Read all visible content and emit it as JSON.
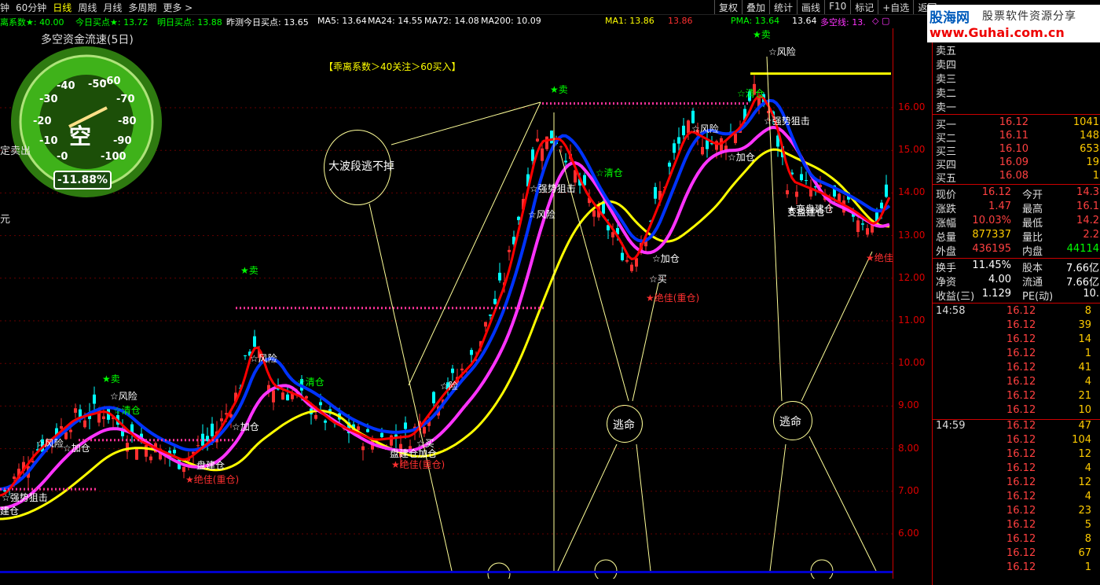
{
  "toolbar": {
    "periods": [
      "钟",
      "60分钟",
      "日线",
      "周线",
      "月线",
      "多周期",
      "更多 >"
    ],
    "active_period_index": 2,
    "buttons": [
      "复权",
      "叠加",
      "统计",
      "画线",
      "F10",
      "标记",
      "+自选",
      "返回"
    ]
  },
  "info_bar": {
    "deviation": "离系数★: 40.00",
    "today_buy": "今日买点★: 13.72",
    "tomorrow_buy": "明日买点: 13.88",
    "predicted": "昨测今日买点: 13.65",
    "ma5": "MA5: 13.64",
    "ma24": "MA24: 14.55",
    "ma72": "MA72: 14.08",
    "ma200": "MA200: 10.09",
    "ma1": "MA1: 13.86",
    "ma1b": "13.86",
    "pma": "PMA: 13.64",
    "pma2": "13.64",
    "kongxian": "多空线: 13."
  },
  "gauge": {
    "title": "多空资金流速(5日)",
    "labels": [
      "-40",
      "-50",
      "-60",
      "-30",
      "-70",
      "-20",
      "-80",
      "-10",
      "-90",
      "-0",
      "-100"
    ],
    "center_text": "空",
    "value": "-11.88%",
    "left_text": "定卖出"
  },
  "left_side_label_1": "元",
  "chart_annotation_top": "【乖离系数＞40关注＞60买入】",
  "circle_labels": {
    "big": "大波段逃不掉",
    "escape1": "逃命",
    "escape2": "逃命"
  },
  "chart_labels": [
    {
      "t": "☆强势狙击",
      "c": "#fff"
    },
    {
      "t": "建仓",
      "c": "#fff"
    },
    {
      "t": "☆风险",
      "c": "#fff"
    },
    {
      "t": "☆加仓",
      "c": "#fff"
    },
    {
      "t": "★卖",
      "c": "#00ff00"
    },
    {
      "t": "☆风险",
      "c": "#fff"
    },
    {
      "t": "☆清仓",
      "c": "#00ff00"
    },
    {
      "t": "盘建仓",
      "c": "#fff"
    },
    {
      "t": "★绝佳(重仓)",
      "c": "#ff3030"
    },
    {
      "t": "★卖",
      "c": "#00ff00"
    },
    {
      "t": "☆风险",
      "c": "#fff"
    },
    {
      "t": "☆清仓",
      "c": "#00ff00"
    },
    {
      "t": "☆加仓",
      "c": "#fff"
    },
    {
      "t": "☆险",
      "c": "#fff"
    },
    {
      "t": "☆买",
      "c": "#fff"
    },
    {
      "t": "盘建仓加仓",
      "c": "#fff"
    },
    {
      "t": "★绝佳(重仓)",
      "c": "#ff3030"
    },
    {
      "t": "★卖",
      "c": "#00ff00"
    },
    {
      "t": "☆强势狙击",
      "c": "#fff"
    },
    {
      "t": "☆风险",
      "c": "#fff"
    },
    {
      "t": "☆清仓",
      "c": "#00ff00"
    },
    {
      "t": "变盘建仓",
      "c": "#fff"
    },
    {
      "t": "☆加仓",
      "c": "#fff"
    },
    {
      "t": "☆买",
      "c": "#fff"
    },
    {
      "t": "★绝佳(重仓)",
      "c": "#ff3030"
    },
    {
      "t": "★卖",
      "c": "#00ff00"
    },
    {
      "t": "☆风险",
      "c": "#fff"
    },
    {
      "t": "☆清仓",
      "c": "#00ff00"
    },
    {
      "t": "☆风险",
      "c": "#fff"
    },
    {
      "t": "☆加仓",
      "c": "#fff"
    },
    {
      "t": "☆强势狙击",
      "c": "#fff"
    },
    {
      "t": "★变盘建仓",
      "c": "#fff"
    },
    {
      "t": "★绝佳",
      "c": "#ff3030"
    }
  ],
  "price_axis": [
    "16.00",
    "15.00",
    "14.00",
    "13.00",
    "12.00",
    "11.00",
    "10.00",
    "9.00",
    "8.00",
    "7.00",
    "6.00"
  ],
  "banner": {
    "logo": "股海网",
    "slogan": "股票软件资源分享",
    "url": "www.Guhai.com.cn"
  },
  "order_book": {
    "sell": [
      "卖五",
      "卖四",
      "卖三",
      "卖二",
      "卖一"
    ],
    "buy": [
      {
        "label": "买一",
        "price": "16.12",
        "vol": "1041"
      },
      {
        "label": "买二",
        "price": "16.11",
        "vol": "148"
      },
      {
        "label": "买三",
        "price": "16.10",
        "vol": "653"
      },
      {
        "label": "买四",
        "price": "16.09",
        "vol": "19"
      },
      {
        "label": "买五",
        "price": "16.08",
        "vol": "1"
      }
    ]
  },
  "quote": [
    {
      "l1": "现价",
      "v1": "16.12",
      "l2": "今开",
      "v2": "14.3",
      "c2": "#ff4040"
    },
    {
      "l1": "涨跌",
      "v1": "1.47",
      "l2": "最高",
      "v2": "16.1",
      "c2": "#ff4040"
    },
    {
      "l1": "涨幅",
      "v1": "10.03%",
      "l2": "最低",
      "v2": "14.2",
      "c2": "#ff4040"
    },
    {
      "l1": "总量",
      "v1": "877337",
      "l2": "量比",
      "v2": "2.2",
      "c2": "#ff4040",
      "c1": "#ffcc00"
    },
    {
      "l1": "外盘",
      "v1": "436195",
      "l2": "内盘",
      "v2": "44114",
      "c2": "#00ff00"
    }
  ],
  "quote2": [
    {
      "l1": "换手",
      "v1": "11.45%",
      "l2": "股本",
      "v2": "7.66亿"
    },
    {
      "l1": "净资",
      "v1": "4.00",
      "l2": "流通",
      "v2": "7.66亿"
    },
    {
      "l1": "收益(三)",
      "v1": "1.129",
      "l2": "PE(动)",
      "v2": "10."
    }
  ],
  "ticks": [
    {
      "time": "14:58",
      "price": "16.12",
      "vol": "8"
    },
    {
      "time": "",
      "price": "16.12",
      "vol": "39"
    },
    {
      "time": "",
      "price": "16.12",
      "vol": "14"
    },
    {
      "time": "",
      "price": "16.12",
      "vol": "1"
    },
    {
      "time": "",
      "price": "16.12",
      "vol": "41"
    },
    {
      "time": "",
      "price": "16.12",
      "vol": "4"
    },
    {
      "time": "",
      "price": "16.12",
      "vol": "21"
    },
    {
      "time": "",
      "price": "16.12",
      "vol": "10"
    },
    {
      "time": "14:59",
      "price": "16.12",
      "vol": "47"
    },
    {
      "time": "",
      "price": "16.12",
      "vol": "104"
    },
    {
      "time": "",
      "price": "16.12",
      "vol": "12"
    },
    {
      "time": "",
      "price": "16.12",
      "vol": "4"
    },
    {
      "time": "",
      "price": "16.12",
      "vol": "12"
    },
    {
      "time": "",
      "price": "16.12",
      "vol": "4"
    },
    {
      "time": "",
      "price": "16.12",
      "vol": "23"
    },
    {
      "time": "",
      "price": "16.12",
      "vol": "5"
    },
    {
      "time": "",
      "price": "16.12",
      "vol": "8"
    },
    {
      "time": "",
      "price": "16.12",
      "vol": "67"
    },
    {
      "time": "",
      "price": "16.12",
      "vol": "1"
    }
  ],
  "colors": {
    "up": "#ff3030",
    "down": "#00ffff",
    "ma_yellow": "#ffff00",
    "ma_magenta": "#ff33ff",
    "ma_blue": "#0033ff",
    "ma_red": "#ff0000",
    "dotted_line": "#ff3399"
  }
}
